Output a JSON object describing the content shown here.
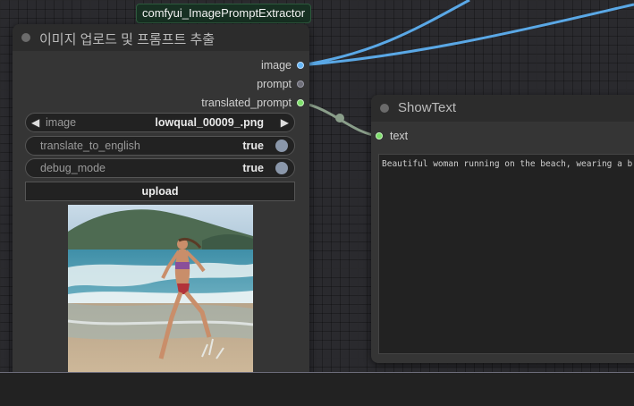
{
  "badge": {
    "label": "comfyui_ImagePromptExtractor"
  },
  "extractor_node": {
    "title": "이미지 업로드 및 프롬프트 추출",
    "outputs": [
      {
        "label": "image",
        "color": "#64b5f6"
      },
      {
        "label": "prompt",
        "color": "#6e6e78"
      },
      {
        "label": "translated_prompt",
        "color": "#7dde6a"
      }
    ],
    "widgets": {
      "image": {
        "name": "image",
        "value": "lowqual_00009_.png"
      },
      "translate_to_english": {
        "name": "translate_to_english",
        "value": "true"
      },
      "debug_mode": {
        "name": "debug_mode",
        "value": "true"
      }
    },
    "upload_label": "upload",
    "preview": {
      "subject": "woman-running-on-beach-photo"
    }
  },
  "show_text_node": {
    "title": "ShowText",
    "input": {
      "label": "text",
      "color": "#7dde6a"
    },
    "text_value": "Beautiful woman running on the beach, wearing a b"
  },
  "colors": {
    "link_image": "#5aa8e6",
    "link_text": "#8a9e8a",
    "canvas_bg": "#2a2a2e",
    "node_bg": "#353535",
    "title_bg": "#2c2c2c"
  }
}
